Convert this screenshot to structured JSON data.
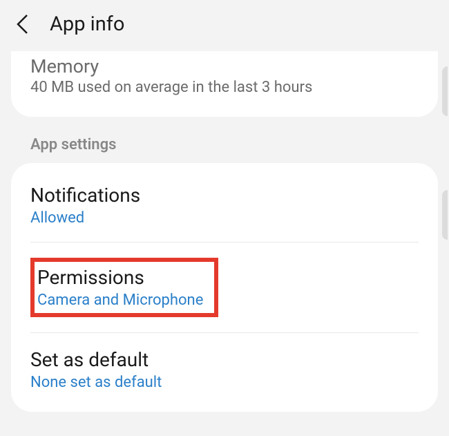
{
  "header": {
    "title": "App info"
  },
  "memory": {
    "title_cut": "Memory",
    "sub": "40 MB used on average in the last 3 hours"
  },
  "section_label": "App settings",
  "notifications": {
    "title": "Notifications",
    "sub": "Allowed"
  },
  "permissions": {
    "title": "Permissions",
    "sub": "Camera and Microphone"
  },
  "set_default": {
    "title": "Set as default",
    "sub": "None set as default"
  }
}
